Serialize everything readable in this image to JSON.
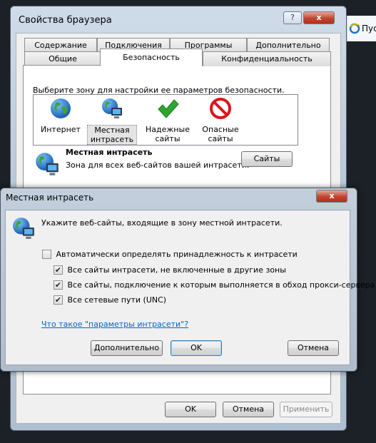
{
  "background_window": {
    "title": "Свойства браузера",
    "help_glyph": "?",
    "close_glyph": "x",
    "tabs_row1": [
      "Содержание",
      "Подключения",
      "Программы",
      "Дополнительно"
    ],
    "tabs_row2": [
      "Общие",
      "Безопасность",
      "Конфиденциальность"
    ],
    "active_tab": "Безопасность",
    "zone_prompt": "Выберите зону для настройки ее параметров безопасности.",
    "zones": [
      {
        "label": "Интернет",
        "icon": "globe-icon"
      },
      {
        "label": "Местная интрасеть",
        "icon": "intranet-icon"
      },
      {
        "label": "Надежные сайты",
        "icon": "checkmark-icon"
      },
      {
        "label": "Опасные сайты",
        "icon": "restricted-icon"
      }
    ],
    "selected_zone_title": "Местная интрасеть",
    "selected_zone_desc": "Зона для всех веб-сайтов вашей интрасети.",
    "sites_button": "Сайты",
    "ok_button": "OK",
    "cancel_button": "Отмена",
    "apply_button": "Применить"
  },
  "browser_strip": {
    "text": "Пус"
  },
  "dialog": {
    "title": "Местная интрасеть",
    "close_glyph": "x",
    "instruction": "Укажите веб-сайты, входящие в зону местной интрасети.",
    "auto_detect": {
      "label": "Автоматически определять принадлежность к интрасети",
      "checked": false
    },
    "options": [
      {
        "label": "Все сайты интрасети, не включенные в другие зоны",
        "checked": true
      },
      {
        "label": "Все сайты, подключение к которым выполняется в обход прокси-сервера",
        "checked": true
      },
      {
        "label": "Все сетевые пути (UNC)",
        "checked": true
      }
    ],
    "help_link": "Что такое \"параметры интрасети\"?",
    "advanced_button": "Дополнительно",
    "ok_button": "OK",
    "cancel_button": "Отмена"
  }
}
